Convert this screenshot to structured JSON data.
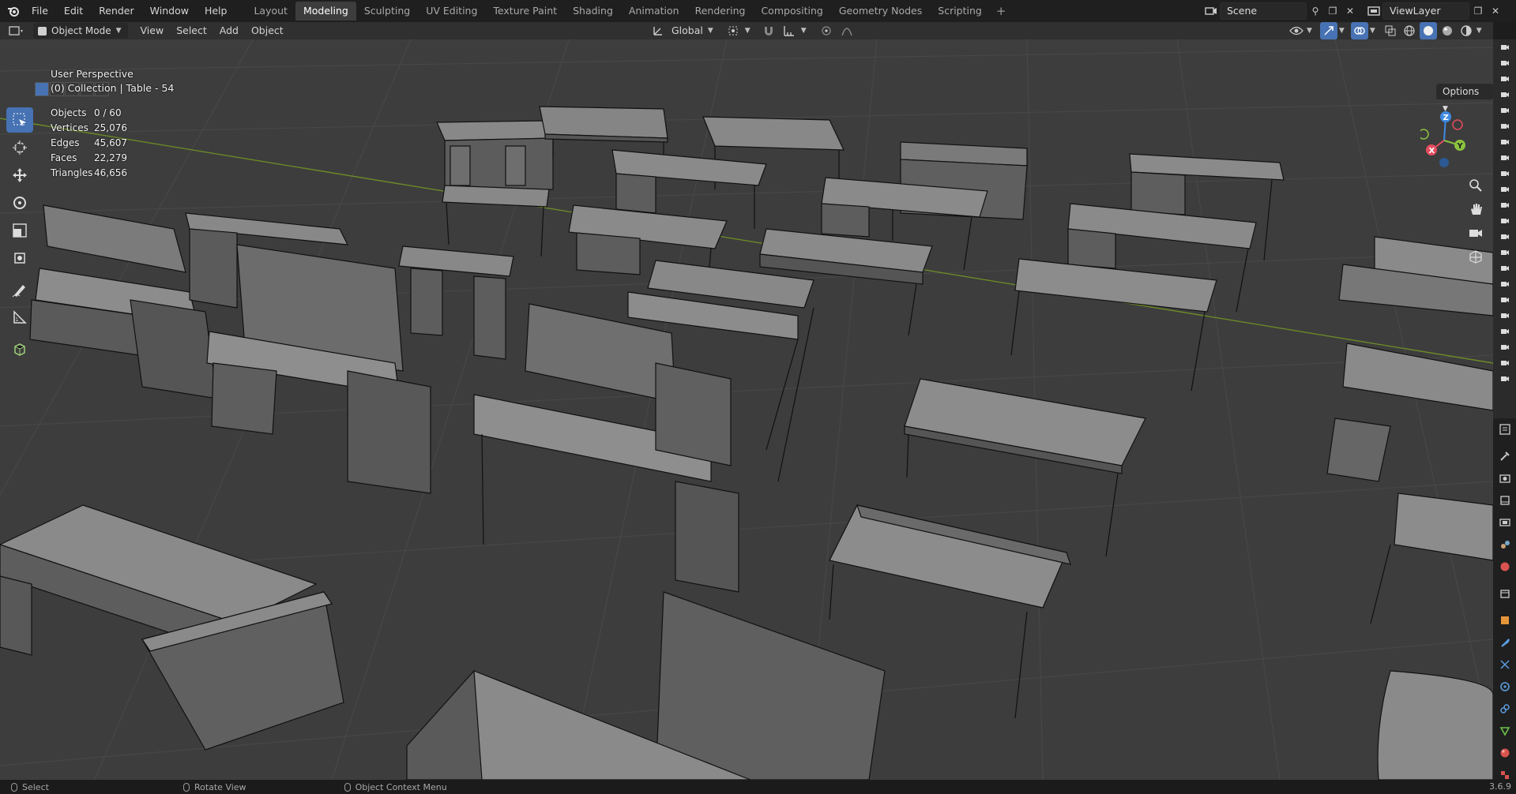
{
  "app": {
    "menu": [
      "File",
      "Edit",
      "Render",
      "Window",
      "Help"
    ],
    "workspaces": [
      "Layout",
      "Modeling",
      "Sculpting",
      "UV Editing",
      "Texture Paint",
      "Shading",
      "Animation",
      "Rendering",
      "Compositing",
      "Geometry Nodes",
      "Scripting"
    ],
    "active_workspace": "Modeling",
    "add_tab": "+",
    "scene": "Scene",
    "view_layer": "ViewLayer"
  },
  "header": {
    "mode": "Object Mode",
    "menus": [
      "View",
      "Select",
      "Add",
      "Object"
    ],
    "transform_orientation": "Global",
    "options": "Options"
  },
  "viewport": {
    "view_name": "User Perspective",
    "collection": "(0) Collection | Table - 54",
    "stats": [
      {
        "label": "Objects",
        "value": "0 / 60"
      },
      {
        "label": "Vertices",
        "value": "25,076"
      },
      {
        "label": "Edges",
        "value": "45,607"
      },
      {
        "label": "Faces",
        "value": "22,279"
      },
      {
        "label": "Triangles",
        "value": "46,656"
      }
    ],
    "gizmo": {
      "x": "X",
      "y": "Y",
      "z": "Z"
    },
    "background_color": "#3d3d3d",
    "grid_color": "#464646",
    "x_axis_color": "#7a2e2e",
    "y_axis_color": "#6b8a28",
    "mesh_fill": "#7b7b7b",
    "mesh_edge": "#000000"
  },
  "statusbar": {
    "left": "Select",
    "middle": "Rotate View",
    "right": "Object Context Menu",
    "version": "3.6.9"
  },
  "tools": [
    "select-box",
    "cursor",
    "move",
    "rotate",
    "scale",
    "transform",
    "annotate",
    "measure",
    "add-cube"
  ],
  "colors": {
    "active_blue": "#4772b3",
    "axis_x": "#e44d5f",
    "axis_y": "#8bc43f",
    "axis_z": "#3f8ae4"
  }
}
